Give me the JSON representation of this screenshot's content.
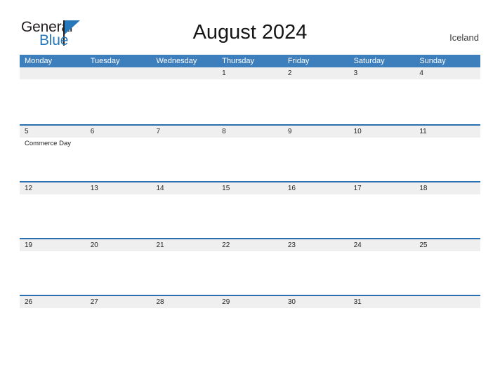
{
  "brand": {
    "name_part1": "General",
    "name_part2": "Blue",
    "flag_icon": "blue-flag-icon",
    "accent_color": "#2777bb"
  },
  "header": {
    "title": "August 2024",
    "locale": "Iceland"
  },
  "theme": {
    "header_blue": "#3d7ebd",
    "band_border_blue": "#2a6fb0",
    "band_gray": "#efefef",
    "page_background": "#ffffff",
    "text_dark": "#262626"
  },
  "calendar": {
    "month": "August",
    "year": "2024",
    "weekday_headers": [
      "Monday",
      "Tuesday",
      "Wednesday",
      "Thursday",
      "Friday",
      "Saturday",
      "Sunday"
    ],
    "weeks": [
      {
        "days": [
          {
            "number": "",
            "events": []
          },
          {
            "number": "",
            "events": []
          },
          {
            "number": "",
            "events": []
          },
          {
            "number": "1",
            "events": []
          },
          {
            "number": "2",
            "events": []
          },
          {
            "number": "3",
            "events": []
          },
          {
            "number": "4",
            "events": []
          }
        ]
      },
      {
        "days": [
          {
            "number": "5",
            "events": [
              "Commerce Day"
            ]
          },
          {
            "number": "6",
            "events": []
          },
          {
            "number": "7",
            "events": []
          },
          {
            "number": "8",
            "events": []
          },
          {
            "number": "9",
            "events": []
          },
          {
            "number": "10",
            "events": []
          },
          {
            "number": "11",
            "events": []
          }
        ]
      },
      {
        "days": [
          {
            "number": "12",
            "events": []
          },
          {
            "number": "13",
            "events": []
          },
          {
            "number": "14",
            "events": []
          },
          {
            "number": "15",
            "events": []
          },
          {
            "number": "16",
            "events": []
          },
          {
            "number": "17",
            "events": []
          },
          {
            "number": "18",
            "events": []
          }
        ]
      },
      {
        "days": [
          {
            "number": "19",
            "events": []
          },
          {
            "number": "20",
            "events": []
          },
          {
            "number": "21",
            "events": []
          },
          {
            "number": "22",
            "events": []
          },
          {
            "number": "23",
            "events": []
          },
          {
            "number": "24",
            "events": []
          },
          {
            "number": "25",
            "events": []
          }
        ]
      },
      {
        "days": [
          {
            "number": "26",
            "events": []
          },
          {
            "number": "27",
            "events": []
          },
          {
            "number": "28",
            "events": []
          },
          {
            "number": "29",
            "events": []
          },
          {
            "number": "30",
            "events": []
          },
          {
            "number": "31",
            "events": []
          },
          {
            "number": "",
            "events": []
          }
        ]
      }
    ]
  }
}
